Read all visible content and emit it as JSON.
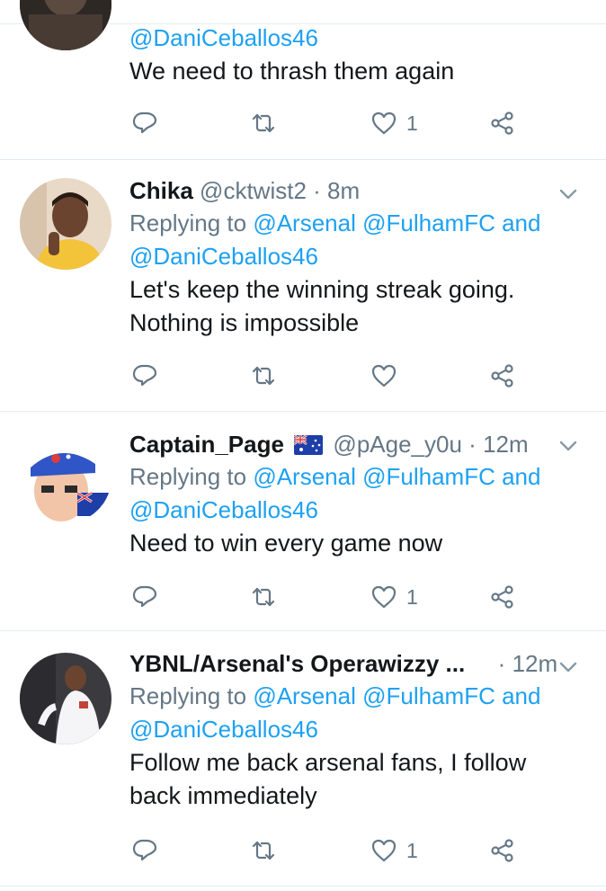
{
  "tweets": [
    {
      "reply_mention": "@DaniCeballos46",
      "text": "We need to thrash them again",
      "likes": "1"
    },
    {
      "name": "Chika",
      "handle": "@cktwist2",
      "dot": "·",
      "time": "8m",
      "replying_prefix": "Replying to",
      "mention1": "@Arsenal",
      "mention2": "@FulhamFC",
      "and": "and",
      "mention3": "@DaniCeballos46",
      "text_line1": "Let's keep the winning streak going.",
      "text_line2": "Nothing is impossible",
      "likes": ""
    },
    {
      "name": "Captain_Page",
      "handle": "@pAge_y0u",
      "dot": "·",
      "time": "12m",
      "replying_prefix": "Replying to",
      "mention1": "@Arsenal",
      "mention2": "@FulhamFC",
      "and": "and",
      "mention3": "@DaniCeballos46",
      "text": "Need to win every game now",
      "likes": "1"
    },
    {
      "name": "YBNL/Arsenal's Operawizzy ...",
      "dot": "·",
      "time": "12m",
      "replying_prefix": "Replying to",
      "mention1": "@Arsenal",
      "mention2": "@FulhamFC",
      "and": "and",
      "mention3": "@DaniCeballos46",
      "text_line1": "Follow me back arsenal fans, I follow",
      "text_line2": "back immediately",
      "likes": "1"
    }
  ],
  "icons": {
    "reply": "reply-icon",
    "retweet": "retweet-icon",
    "like": "heart-icon",
    "share": "share-icon",
    "more": "chevron-down-icon"
  },
  "colors": {
    "link": "#1da1f2",
    "secondary_text": "#657786",
    "divider": "#e6ecf0"
  }
}
